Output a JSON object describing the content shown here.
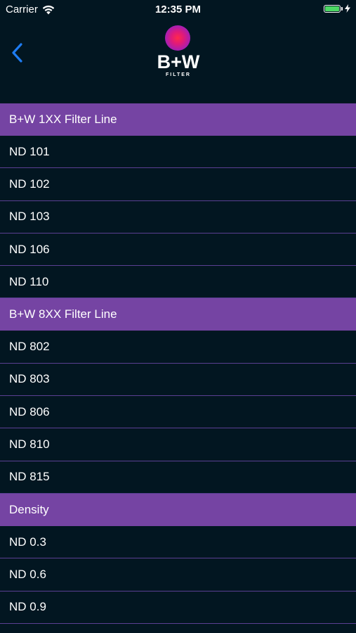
{
  "status_bar": {
    "carrier": "Carrier",
    "time": "12:35 PM",
    "battery_color": "#4cd964"
  },
  "nav": {
    "back_icon": "chevron-left-icon",
    "back_color": "#1e7cf2",
    "logo_text": "B+W",
    "logo_subtext": "FILTER"
  },
  "colors": {
    "background": "#021621",
    "section_header": "#7544a3",
    "separator": "#5a3f93"
  },
  "sections": [
    {
      "title": "B+W 1XX Filter Line",
      "items": [
        "ND 101",
        "ND 102",
        "ND 103",
        "ND 106",
        "ND 110"
      ]
    },
    {
      "title": "B+W 8XX Filter Line",
      "items": [
        "ND 802",
        "ND 803",
        "ND 806",
        "ND 810",
        "ND 815"
      ]
    },
    {
      "title": "Density",
      "items": [
        "ND 0.3",
        "ND 0.6",
        "ND 0.9"
      ]
    }
  ]
}
